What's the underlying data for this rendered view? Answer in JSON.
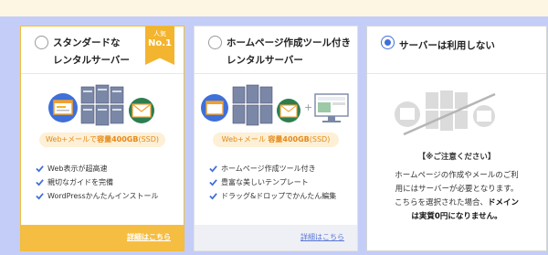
{
  "colors": {
    "accent": "#f3b42f",
    "selected": "#3f6fd8",
    "link_alt": "#5b78d6",
    "page_bg": "#c4cdf8"
  },
  "plans": [
    {
      "title_line1": "スタンダードな",
      "title_line2": "レンタルサーバー",
      "badge_top": "人気",
      "badge_main": "No.1",
      "pill_prefix": "Web+メールで",
      "pill_strong": "容量400GB",
      "pill_suffix": "(SSD)",
      "features": [
        "Web表示が超高速",
        "親切なガイドを完備",
        "WordPressかんたんインストール"
      ],
      "link": "詳細はこちら",
      "selected": false
    },
    {
      "title_line1": "ホームページ作成ツール付き",
      "title_line2": "レンタルサーバー",
      "pill_prefix": "Web+メール",
      "pill_strong": "容量400GB",
      "pill_suffix": "(SSD)",
      "features": [
        "ホームページ作成ツール付き",
        "豊富な美しいテンプレート",
        "ドラッグ&ドロップでかんたん編集"
      ],
      "link": "詳細はこちら",
      "selected": false
    },
    {
      "title_line1": "サーバーは利用しない",
      "notice_head": "【※ご注意ください】",
      "notice_lines": [
        "ホームページの作成やメールのご利",
        "用にはサーバーが必要となります。",
        "こちらを選択された場合、",
        "は実質0円になりません。"
      ],
      "notice_strong": "ドメイン",
      "selected": true
    }
  ]
}
